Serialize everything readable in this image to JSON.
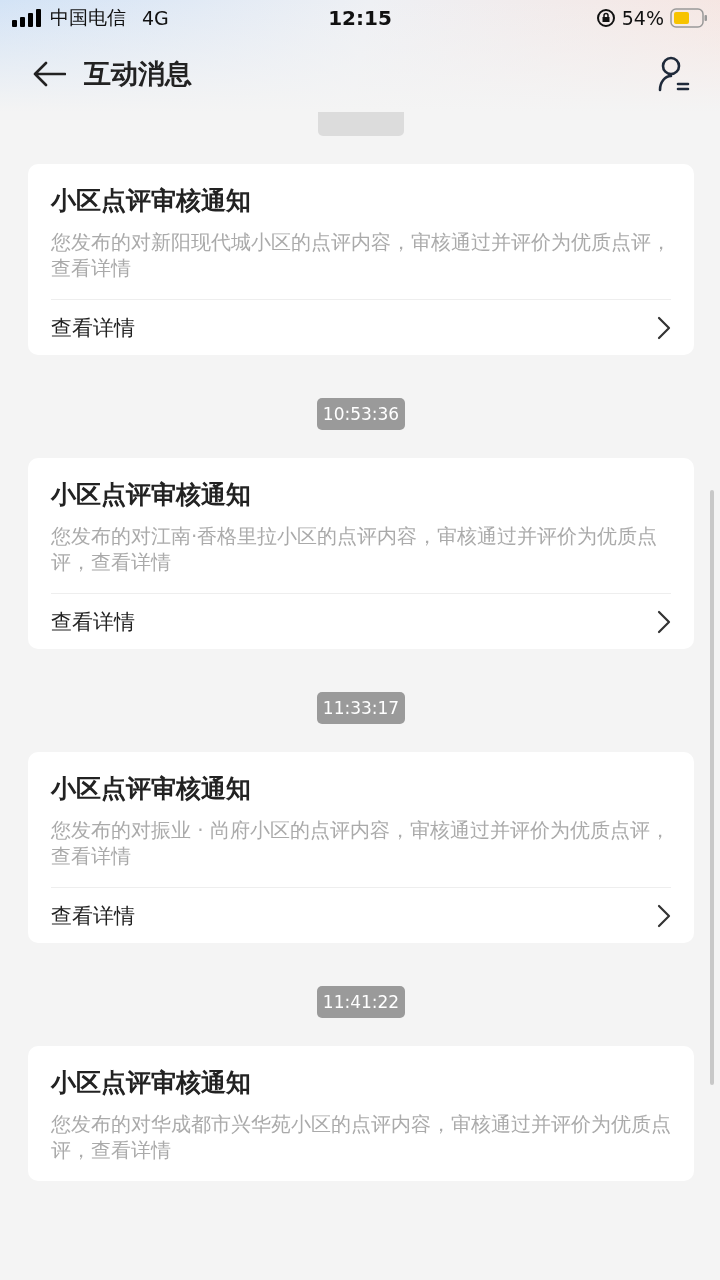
{
  "status_bar": {
    "carrier": "中国电信",
    "network": "4G",
    "time": "12:15",
    "battery": "54%"
  },
  "header": {
    "title": "互动消息"
  },
  "messages": [
    {
      "title": "小区点评审核通知",
      "body": "您发布的对新阳现代城小区的点评内容，审核通过并评价为优质点评，查看详情",
      "link": "查看详情"
    },
    {
      "time": "10:53:36",
      "title": "小区点评审核通知",
      "body": "您发布的对江南·香格里拉小区的点评内容，审核通过并评价为优质点评，查看详情",
      "link": "查看详情"
    },
    {
      "time": "11:33:17",
      "title": "小区点评审核通知",
      "body": "您发布的对振业 · 尚府小区的点评内容，审核通过并评价为优质点评，查看详情",
      "link": "查看详情"
    },
    {
      "time": "11:41:22",
      "title": "小区点评审核通知",
      "body": "您发布的对华成都市兴华苑小区的点评内容，审核通过并评价为优质点评，查看详情"
    }
  ]
}
